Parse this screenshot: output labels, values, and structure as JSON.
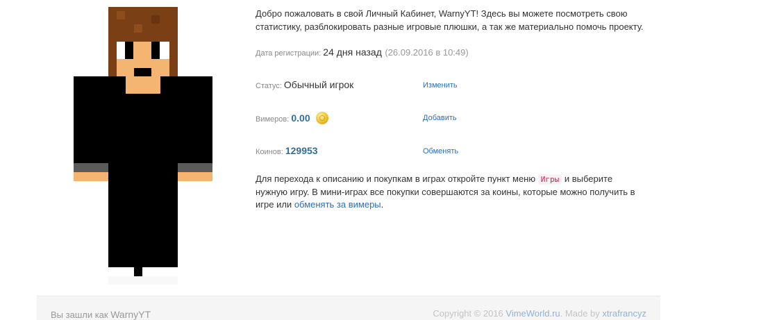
{
  "welcome": {
    "text": "Добро пожаловать в свой Личный Кабинет, WarnyYT! Здесь вы можете посмотреть свою статистику, разблокировать разные игровые плюшки, а так же материально помочь проекту."
  },
  "registration": {
    "label": "Дата регистрации",
    "value": "24 дня назад",
    "date": "(26.09.2016 в 10:49)"
  },
  "status": {
    "label": "Статус",
    "value": "Обычный игрок",
    "action": "Изменить"
  },
  "vimers": {
    "label": "Вимеров",
    "value": "0.00",
    "icon": "gold-coin-icon",
    "action": "Добавить"
  },
  "coins": {
    "label": "Коинов",
    "value": "129953",
    "action": "Обменять"
  },
  "info": {
    "part1": "Для перехода к описанию и покупкам в играх откройте пункт меню",
    "menu_tag": "Игры",
    "part2": "и выберите нужную игру. В мини-играх все покупки совершаются за коины, которые можно получить в игре или",
    "link": "обменять за вимеры",
    "end": "."
  },
  "footer": {
    "logged_in_prefix": "Вы зашли как",
    "username": "WarnyYT",
    "copyright": "Copyright © 2016",
    "site_link": "VimeWorld.ru",
    "made_by": "Made by",
    "author_link": "xtrafrancyz"
  },
  "colors": {
    "hair": "#7a3f14",
    "hair_light": "#8e4d1c",
    "skin": "#f4b573",
    "shirt": "#000000",
    "sleeve_band": "#5b5b5b",
    "link": "#2a6ebb",
    "value_blue": "#2f6f9a",
    "code_red": "#c7254e"
  }
}
